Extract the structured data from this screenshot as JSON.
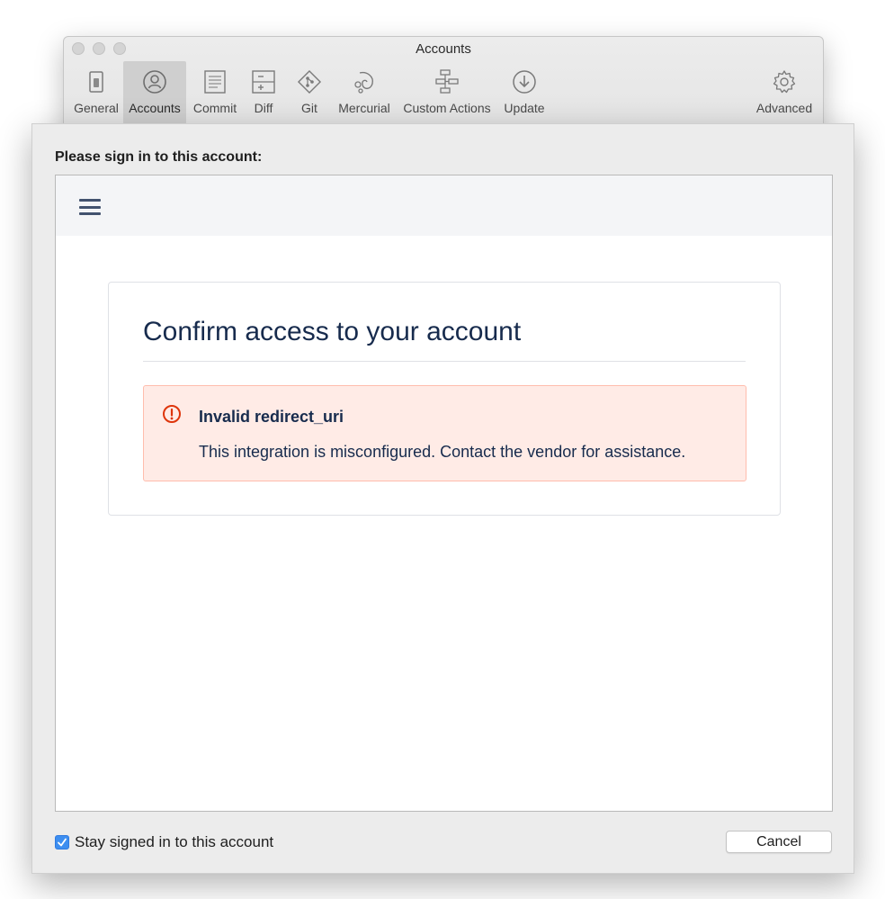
{
  "window": {
    "title": "Accounts"
  },
  "toolbar": {
    "items": [
      {
        "label": "General",
        "icon": "switch-icon"
      },
      {
        "label": "Accounts",
        "icon": "user-circle-icon",
        "active": true
      },
      {
        "label": "Commit",
        "icon": "document-lines-icon"
      },
      {
        "label": "Diff",
        "icon": "diff-icon"
      },
      {
        "label": "Git",
        "icon": "git-icon"
      },
      {
        "label": "Mercurial",
        "icon": "mercurial-icon"
      },
      {
        "label": "Custom Actions",
        "icon": "flowchart-icon"
      },
      {
        "label": "Update",
        "icon": "download-circle-icon"
      },
      {
        "label": "Advanced",
        "icon": "gear-icon"
      }
    ]
  },
  "sheet": {
    "prompt": "Please sign in to this account:",
    "stay_signed_in": {
      "label": "Stay signed in to this account",
      "checked": true
    },
    "cancel_label": "Cancel"
  },
  "webview": {
    "menu_icon": "hamburger-menu-icon",
    "card_title": "Confirm access to your account",
    "error": {
      "icon": "error-circle-icon",
      "title": "Invalid redirect_uri",
      "message": "This integration is misconfigured. Contact the vendor for assistance."
    }
  },
  "colors": {
    "accent": "#3d8ef0",
    "error_background": "#ffebe6",
    "error_border": "#ffbdad",
    "error_icon": "#de350b",
    "heading_text": "#172b4d"
  }
}
